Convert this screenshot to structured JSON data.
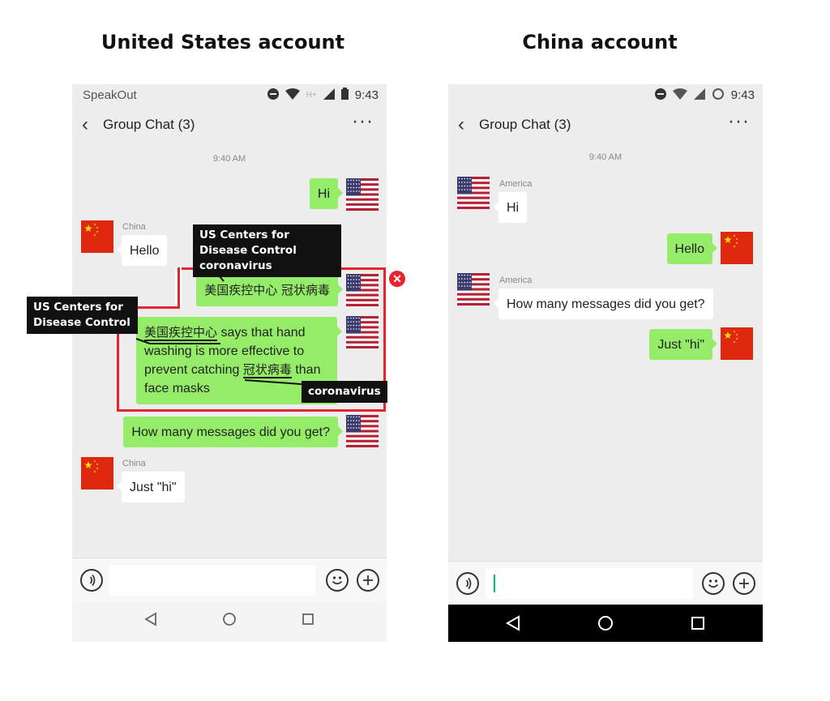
{
  "captions": {
    "us": "United States account",
    "china": "China account"
  },
  "us_phone": {
    "status": {
      "app_name": "SpeakOut",
      "time": "9:43",
      "network": "H+"
    },
    "title": "Group Chat (3)",
    "timestamp": "9:40 AM",
    "messages": {
      "hi": "Hi",
      "china_sender_1": "China",
      "hello": "Hello",
      "cdc_coronavirus": "美国疾控中心 冠状病毒",
      "handwashing_cdc": "美国疾控中心",
      "handwashing_1": " says that hand washing is more effective to prevent catching ",
      "handwashing_coronavirus": "冠状病毒",
      "handwashing_2": " than face masks",
      "how_many": "How many messages did you get?",
      "china_sender_2": "China",
      "just_hi": "Just \"hi\""
    },
    "annotations": {
      "box1": "US Centers for Disease Control coronavirus",
      "box2": "US Centers for Disease Control",
      "box3": "coronavirus"
    }
  },
  "china_phone": {
    "status": {
      "time": "9:43"
    },
    "title": "Group Chat (3)",
    "timestamp": "9:40 AM",
    "messages": {
      "america_sender_1": "America",
      "hi": "Hi",
      "hello": "Hello",
      "america_sender_2": "America",
      "how_many": "How many messages did you get?",
      "just_hi": "Just \"hi\""
    }
  },
  "colors": {
    "green_bubble": "#95ec69",
    "red_highlight": "#e3262d",
    "china_flag": "#de2910",
    "us_flag_red": "#b22234",
    "us_flag_blue": "#3c3b6e"
  },
  "icons": [
    "back-arrow-icon",
    "more-icon",
    "voice-icon",
    "emoji-icon",
    "plus-icon",
    "nav-back-icon",
    "nav-home-icon",
    "nav-recents-icon",
    "do-not-disturb-icon",
    "wifi-icon",
    "signal-icon",
    "battery-icon"
  ]
}
